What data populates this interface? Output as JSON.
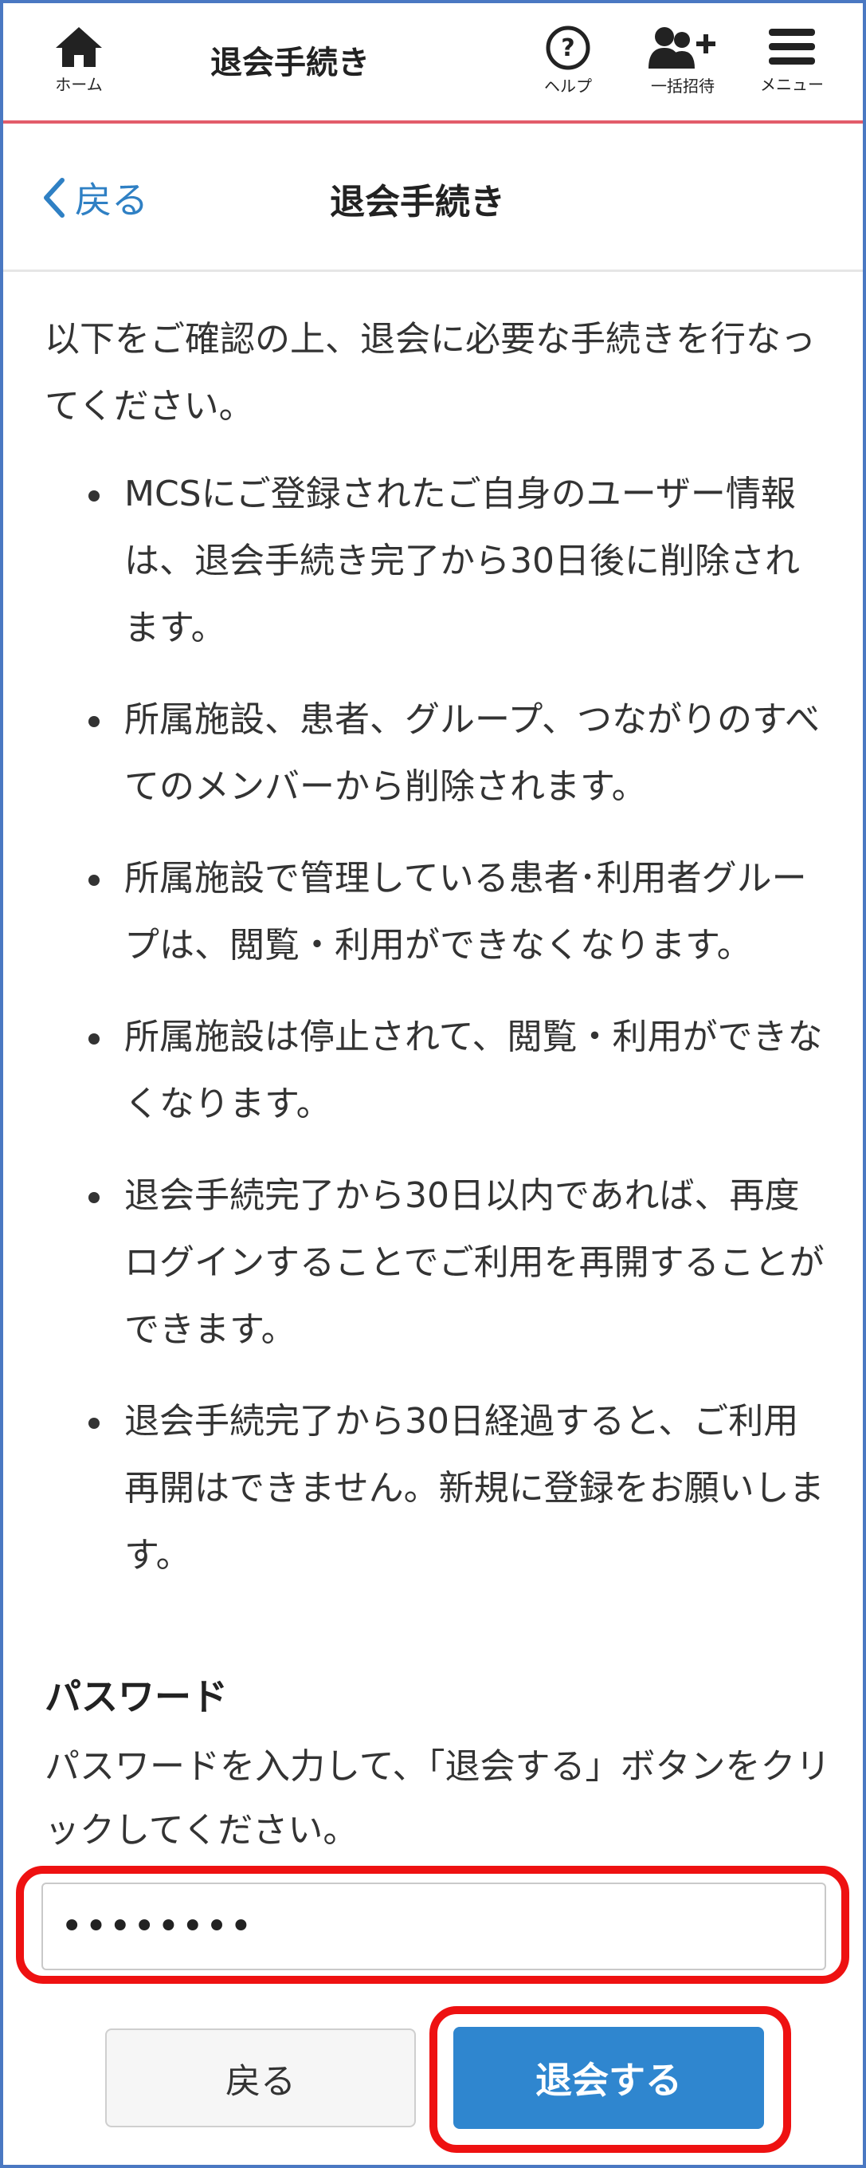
{
  "header": {
    "home_label": "ホーム",
    "title": "退会手続き",
    "help_label": "ヘルプ",
    "invite_label": "一括招待",
    "menu_label": "メニュー",
    "accent_color": "#e25c6a"
  },
  "subheader": {
    "back_label": "戻る",
    "title": "退会手続き"
  },
  "content": {
    "intro": "以下をご確認の上、退会に必要な手続きを行なってください。",
    "bullets": [
      "MCSにご登録されたご自身のユーザー情報は、退会手続き完了から30日後に削除されます。",
      "所属施設、患者、グループ、つながりのすべてのメンバーから削除されます。",
      "所属施設で管理している患者･利用者グループは、閲覧・利用ができなくなります。",
      "所属施設は停止されて、閲覧・利用ができなくなります。",
      "退会手続完了から30日以内であれば、再度ログインすることでご利用を再開することができます。",
      "退会手続完了から30日経過すると、ご利用再開はできません。新規に登録をお願いします。"
    ]
  },
  "password": {
    "label": "パスワード",
    "help": "パスワードを入力して、「退会する」ボタンをクリックしてください。",
    "value": "••••••••"
  },
  "buttons": {
    "back_label": "戻る",
    "withdraw_label": "退会する",
    "primary_color": "#2f86cf",
    "highlight_color": "#ee1111"
  }
}
